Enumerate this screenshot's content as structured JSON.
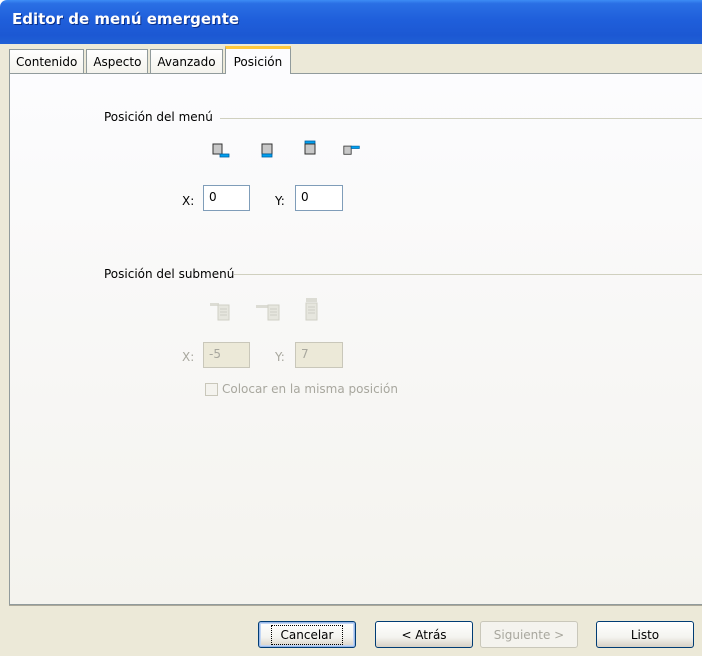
{
  "window": {
    "title": "Editor de menú emergente"
  },
  "tabs": [
    {
      "label": "Contenido",
      "active": false
    },
    {
      "label": "Aspecto",
      "active": false
    },
    {
      "label": "Avanzado",
      "active": false
    },
    {
      "label": "Posición",
      "active": true
    }
  ],
  "menu_position": {
    "group_label": "Posición del menú",
    "icons": [
      "menu-below-left-icon",
      "menu-below-icon",
      "menu-above-icon",
      "menu-right-icon"
    ],
    "x_label": "X:",
    "x_value": "0",
    "y_label": "Y:",
    "y_value": "0"
  },
  "submenu_position": {
    "group_label": "Posición del submenú",
    "icons": [
      "submenu-top-right-icon",
      "submenu-right-icon",
      "submenu-below-icon"
    ],
    "x_label": "X:",
    "x_value": "-5",
    "y_label": "Y:",
    "y_value": "7",
    "same_position_label": "Colocar en la misma posición",
    "same_position_checked": false,
    "disabled": true
  },
  "buttons": {
    "cancel": "Cancelar",
    "back": "< Atrás",
    "next": "Siguiente >",
    "done": "Listo"
  },
  "colors": {
    "titlebar": "#1f5fdb",
    "window_bg": "#ece9d8",
    "tab_highlight": "#ffc83c",
    "icon_accent": "#00a0f0"
  }
}
